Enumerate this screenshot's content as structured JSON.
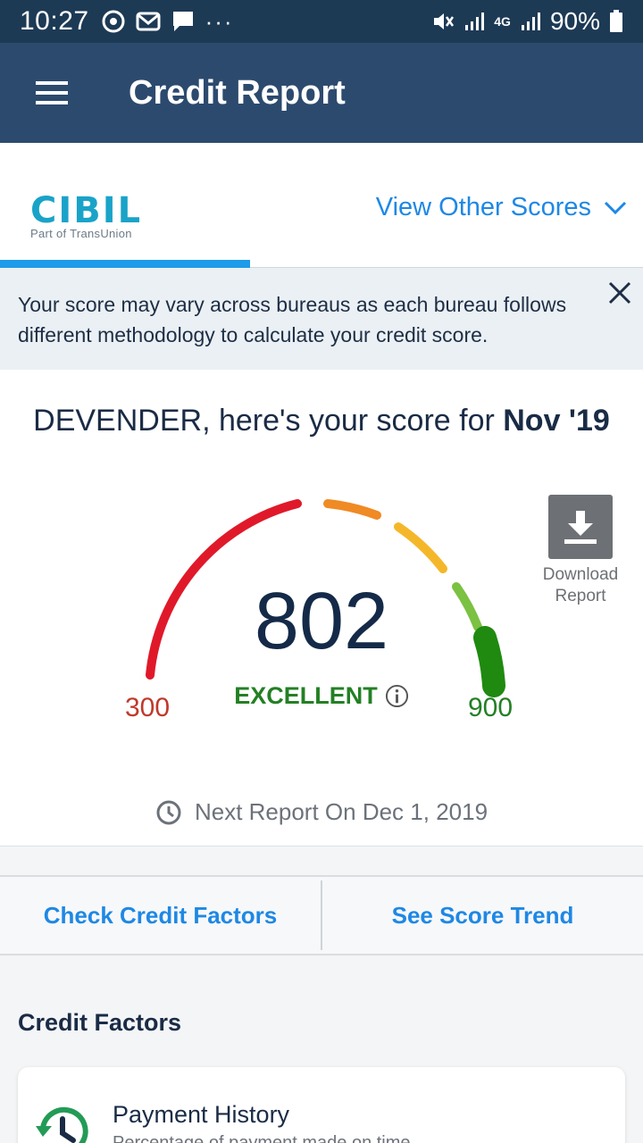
{
  "status_bar": {
    "time": "10:27",
    "battery": "90%",
    "network": "4G"
  },
  "app_bar": {
    "title": "Credit Report"
  },
  "bureau": {
    "logo_text": "CIBIL",
    "logo_sub": "Part of TransUnion",
    "other_scores_label": "View Other Scores"
  },
  "notice": {
    "text": "Your score may vary across bureaus as each bureau follows different methodology to calculate your credit score."
  },
  "score": {
    "greeting_prefix": "DEVENDER, here's your score for ",
    "month": "Nov '19",
    "value": "802",
    "rating": "EXCELLENT",
    "min": "300",
    "max": "900",
    "download_line1": "Download",
    "download_line2": "Report",
    "next_report": "Next Report On Dec 1, 2019"
  },
  "actions": {
    "check_factors": "Check Credit Factors",
    "score_trend": "See Score Trend"
  },
  "factors": {
    "section_title": "Credit Factors",
    "items": [
      {
        "title": "Payment History",
        "description": "Percentage of payment made on time"
      }
    ]
  },
  "colors": {
    "header": "#2c4a6e",
    "status_bar": "#1d3a55",
    "accent": "#1e88e5",
    "excellent": "#238024",
    "poor": "#c0392b"
  }
}
